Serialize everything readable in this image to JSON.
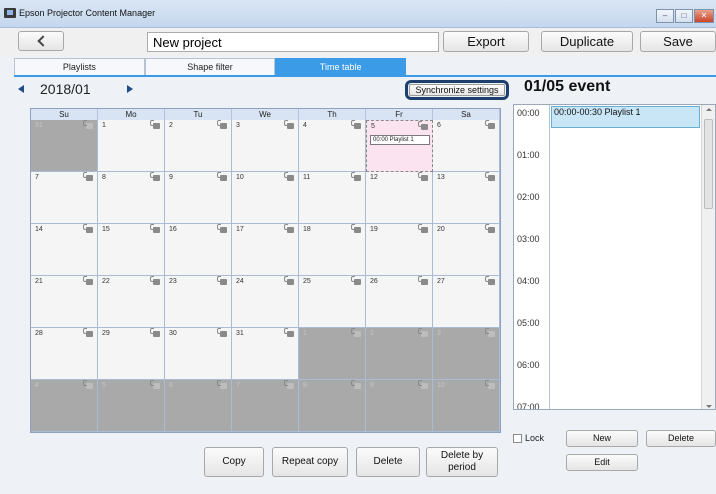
{
  "window": {
    "title": "Epson Projector Content Manager"
  },
  "toolbar": {
    "project_name": "New project",
    "export_label": "Export",
    "duplicate_label": "Duplicate",
    "save_label": "Save"
  },
  "tabs": [
    {
      "label": "Playlists",
      "active": false
    },
    {
      "label": "Shape filter",
      "active": false
    },
    {
      "label": "Time table",
      "active": true
    }
  ],
  "calendar": {
    "month_label": "2018/01",
    "sync_label": "Synchronize settings",
    "weekdays": [
      "Su",
      "Mo",
      "Tu",
      "We",
      "Th",
      "Fr",
      "Sa"
    ],
    "days": [
      {
        "num": "31",
        "out": true
      },
      {
        "num": "1"
      },
      {
        "num": "2"
      },
      {
        "num": "3"
      },
      {
        "num": "4"
      },
      {
        "num": "5",
        "today": true,
        "event": "00:00 Playlist 1"
      },
      {
        "num": "6"
      },
      {
        "num": "7"
      },
      {
        "num": "8"
      },
      {
        "num": "9"
      },
      {
        "num": "10"
      },
      {
        "num": "11"
      },
      {
        "num": "12"
      },
      {
        "num": "13"
      },
      {
        "num": "14"
      },
      {
        "num": "15"
      },
      {
        "num": "16"
      },
      {
        "num": "17"
      },
      {
        "num": "18"
      },
      {
        "num": "19"
      },
      {
        "num": "20"
      },
      {
        "num": "21"
      },
      {
        "num": "22"
      },
      {
        "num": "23"
      },
      {
        "num": "24"
      },
      {
        "num": "25"
      },
      {
        "num": "26"
      },
      {
        "num": "27"
      },
      {
        "num": "28"
      },
      {
        "num": "29"
      },
      {
        "num": "30"
      },
      {
        "num": "31"
      },
      {
        "num": "1",
        "out": true
      },
      {
        "num": "2",
        "out": true
      },
      {
        "num": "3",
        "out": true
      },
      {
        "num": "4",
        "out": true
      },
      {
        "num": "5",
        "out": true
      },
      {
        "num": "6",
        "out": true
      },
      {
        "num": "7",
        "out": true
      },
      {
        "num": "8",
        "out": true
      },
      {
        "num": "9",
        "out": true
      },
      {
        "num": "10",
        "out": true
      }
    ]
  },
  "actions": {
    "copy": "Copy",
    "repeat_copy": "Repeat copy",
    "delete": "Delete",
    "delete_by_period_line1": "Delete by",
    "delete_by_period_line2": "period"
  },
  "event_panel": {
    "title": "01/05 event",
    "times": [
      "00:00",
      "01:00",
      "02:00",
      "03:00",
      "04:00",
      "05:00",
      "06:00",
      "07:00"
    ],
    "item": "00:00-00:30 Playlist 1",
    "lock_label": "Lock",
    "new_label": "New",
    "delete_label": "Delete",
    "edit_label": "Edit"
  }
}
